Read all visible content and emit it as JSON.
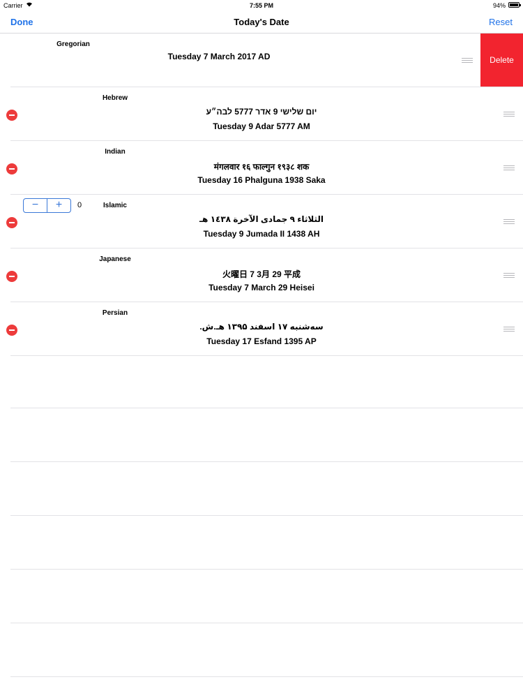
{
  "status_bar": {
    "carrier": "Carrier",
    "wifi_icon": "wifi-icon",
    "time": "7:55 PM",
    "battery": "94%",
    "battery_level": 0.94
  },
  "nav": {
    "done_label": "Done",
    "title": "Today's Date",
    "reset_label": "Reset"
  },
  "rows": [
    {
      "name": "Gregorian",
      "english": "Tuesday 7 March 2017 AD",
      "delete_label": "Delete"
    },
    {
      "name": "Hebrew",
      "native": "יום שלישי 9 אדר 5777 לבה״ע",
      "english": "Tuesday  9 Adar 5777 AM"
    },
    {
      "name": "Indian",
      "native": "मंगलवार १६ फाल्गुन १९३८ शक",
      "english": "Tuesday  16 Phalguna 1938 Saka"
    },
    {
      "name": "Islamic",
      "native": "الثلاثاء ٩ جمادى الآخرة ١٤٣٨ هـ",
      "english": "Tuesday  9 Jumada II 1438 AH",
      "stepper_minus": "−",
      "stepper_plus": "+",
      "stepper_value": "0"
    },
    {
      "name": "Japanese",
      "native": "火曜日 7 3月 29 平成",
      "english": "Tuesday  7 March 29 Heisei"
    },
    {
      "name": "Persian",
      "native": "سه‌شنبه ۱۷ اسفند ۱۳۹۵ هـ.ش.",
      "english": "Tuesday  17 Esfand 1395 AP"
    }
  ],
  "colors": {
    "accent": "#1f72e8",
    "delete": "#f2242f",
    "remove": "#ed3b3b"
  }
}
